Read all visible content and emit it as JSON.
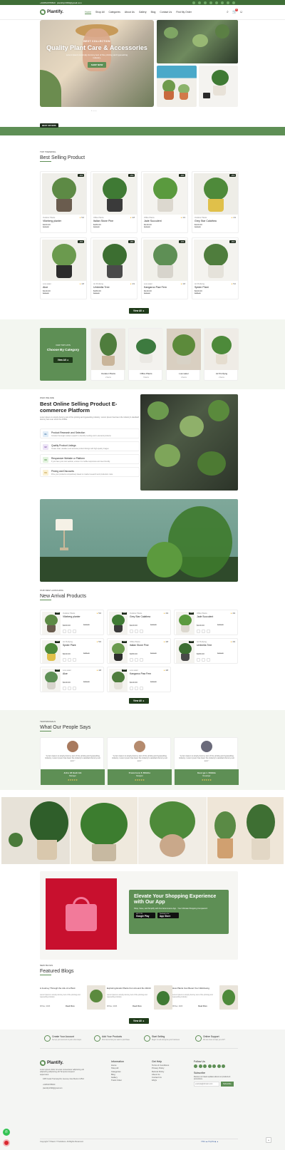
{
  "topbar": {
    "phone": "+919510765810",
    "email": "planttifyr2099@gmail.com"
  },
  "nav": {
    "brand": "Plantify.",
    "menu": [
      "Home",
      "Shop All",
      "Categories",
      "About Us",
      "Gallery",
      "Blog",
      "Contact Us",
      "Find My Order"
    ],
    "cart_count": "0"
  },
  "hero": {
    "kicker": "BEST COLLECTION",
    "title": "Quality Plant Care & Accessories",
    "desc": "Lorem Ipsum is simply dummy text of the printing and typesetting industry.",
    "cta": "SHOP NOW",
    "dots": "• ——"
  },
  "band_tag": "BEST OFFERS",
  "best": {
    "kicker": "TOP TRENDING",
    "title": "Best Selling Product",
    "view_all": "View All",
    "products": [
      {
        "badge": "-16%",
        "cat": "Outdoor Plants",
        "rating": "5.0",
        "name": "Vikeberg planter",
        "price": "$100.00",
        "old": "$120.00"
      },
      {
        "badge": "-15%",
        "cat": "Office Plants",
        "rating": "4.8",
        "name": "Italian Stone Pine",
        "price": "$180.00",
        "old": "$210.00"
      },
      {
        "badge": "-18%",
        "cat": "Office Plants",
        "rating": "4.9",
        "name": "Jade Succulent",
        "price": "$140.00",
        "old": "$170.00"
      },
      {
        "badge": "-15%",
        "cat": "Outdoor Plants",
        "rating": "4.9",
        "name": "Grey Star Calathea",
        "price": "$120.00",
        "old": "$140.00"
      },
      {
        "badge": "-15%",
        "cat": "Low water",
        "rating": "4.8",
        "name": "Aloe",
        "price": "$140.00",
        "old": "$160.00"
      },
      {
        "badge": "-18%",
        "cat": "Air Purifying",
        "rating": "4.9",
        "name": "Umbrella Tree",
        "price": "$180.00",
        "old": "$220.00"
      },
      {
        "badge": "-13%",
        "cat": "Low water",
        "rating": "4.8",
        "name": "Kangaroo Paw Fern",
        "price": "$140.00",
        "old": "$160.00"
      },
      {
        "badge": "-16%",
        "cat": "Air Purifying",
        "rating": "5.0",
        "name": "Spider Plant",
        "price": "$240.00",
        "old": "$285.00"
      }
    ]
  },
  "categories": {
    "kicker": "OUR TOP CATS",
    "title": "Choose By Category",
    "view_all": "View All",
    "items": [
      {
        "name": "Outdoor Plants",
        "qty": "2 items"
      },
      {
        "name": "Office Plants",
        "qty": "3 items"
      },
      {
        "name": "Low water",
        "qty": "2 items"
      },
      {
        "name": "Air Purifying",
        "qty": "2 items"
      }
    ]
  },
  "about": {
    "kicker": "WHO WE ARE",
    "title": "Best Online Selling Product E-commerce Platform",
    "desc": "Lorem Ipsum is simply dummy text of the printing and typesetting industry. Lorem Ipsum has been the industry's standard dummy text ever since the 1500s.",
    "steps": [
      {
        "num": "01",
        "title": "Product Research and Selection",
        "desc": "Conduct thorough market research to identify trending and in-demand products."
      },
      {
        "num": "02",
        "title": "Quality Product Listings",
        "desc": "Create clear, detailed, and accurate product listings with high-quality images."
      },
      {
        "num": "03",
        "title": "Responsive Website or Platform",
        "desc": "If you have your own website, ensure it is mobile-responsive and user-friendly."
      },
      {
        "num": "04",
        "title": "Pricing and Discounts",
        "desc": "Price your products competitively based on market research and production costs."
      }
    ]
  },
  "arrivals": {
    "kicker": "OUR NEW LAUNCHING",
    "title": "New Arrival Products",
    "view_all": "View All",
    "products": [
      {
        "badge": "-16%",
        "cat": "Outdoor Plants",
        "rating": "5.0",
        "name": "Vikeberg planter",
        "price": "$100.00",
        "old": "$120.00"
      },
      {
        "badge": "-15%",
        "cat": "Outdoor Plants",
        "rating": "4.9",
        "name": "Grey Star Calathea",
        "price": "$120.00",
        "old": "$140.00"
      },
      {
        "badge": "-18%",
        "cat": "Office Plants",
        "rating": "4.9",
        "name": "Jade Succulent",
        "price": "$140.00",
        "old": "$170.00"
      },
      {
        "badge": "-16%",
        "cat": "Air Purifying",
        "rating": "5.0",
        "name": "Spider Plant",
        "price": "$240.00",
        "old": "$285.00"
      },
      {
        "badge": "-15%",
        "cat": "Office Plants",
        "rating": "4.8",
        "name": "Italian Stone Pine",
        "price": "$180.00",
        "old": "$210.00"
      },
      {
        "badge": "-18%",
        "cat": "Air Purifying",
        "rating": "4.9",
        "name": "Umbrella Tree",
        "price": "$180.00",
        "old": "$220.00"
      },
      {
        "badge": "-15%",
        "cat": "Low water",
        "rating": "4.8",
        "name": "Aloe",
        "price": "$140.00",
        "old": "$160.00"
      },
      {
        "badge": "-13%",
        "cat": "Low water",
        "rating": "4.8",
        "name": "Kangaroo Paw Fern",
        "price": "$140.00",
        "old": "$160.00"
      }
    ]
  },
  "testimonials": {
    "kicker": "TESTIMONIALS",
    "title": "What Our People Says",
    "quote": "\"Lorem Ipsum is simply dummy text of the printing and typesetting industry. Lorem Ipsum has been the industry's standard dummy text ever.\"",
    "items": [
      {
        "name": "Jolie M Hedrick",
        "role": "Manager"
      },
      {
        "name": "Francisca S Dibble",
        "role": "Designer"
      },
      {
        "name": "George L Dibble",
        "role": "Developer"
      }
    ],
    "stars": "★★★★★"
  },
  "app": {
    "title": "Elevate Your Shopping Experience with Our App",
    "desc": "Shop, Save, and Simplify with Our Ecommerce App - Your Ultimate Shopping Companion!",
    "google": "Google Play",
    "apple": "App Store",
    "google_small": "GET IT ON",
    "apple_small": "Download on the"
  },
  "blogs": {
    "kicker": "NEW BLOGS",
    "title": "Featured Blogs",
    "view_all": "View All",
    "items": [
      {
        "title": "A Journey Through the Life of a Plant",
        "desc": "Lorem Ipsum is simply dummy text of the printing and typesetting industry.",
        "date": "08 Dec, 2023",
        "more": "Read More"
      },
      {
        "title": "Exploring Exotic Plants from Around the World",
        "desc": "Lorem Ipsum is simply dummy text of the printing and typesetting industry.",
        "date": "08 Dec, 2023",
        "more": "Read More"
      },
      {
        "title": "How Plants Can Boost Your Well-being",
        "desc": "Lorem Ipsum is simply dummy text of the printing and typesetting industry.",
        "date": "08 Dec, 2023",
        "more": "Read More"
      }
    ]
  },
  "features": [
    {
      "title": "Create Your Account",
      "desc": "Set up your account in just a few steps"
    },
    {
      "title": "Add Your Products",
      "desc": "Pick items that you want to purchase"
    },
    {
      "title": "Start Selling",
      "desc": "Begin to sell and grow your business"
    },
    {
      "title": "Online Support",
      "desc": "We are here to help you 24/7"
    }
  ],
  "footer": {
    "brand": "Plantify.",
    "about": "Lorem ipsum dolor sit amet consectetur adipiscing elit adipiscing adipiscing elit Tempora torquent aspernatur.",
    "address": "4305 Cedar Tramway Rd, Geneva, New Mexico 12512",
    "phone": "+919510765810",
    "email": "planttifyr2099@gmail.com",
    "info_h": "Information",
    "info": [
      "Home",
      "Shop All",
      "Categories",
      "Blog",
      "Gallery",
      "Track Order"
    ],
    "help_h": "Get Help",
    "help": [
      "Terms & Conditions",
      "Privacy Policy",
      "Refund Policy",
      "About Us",
      "Contact Us",
      "FAQs"
    ],
    "follow_h": "Follow Us",
    "subscribe_h": "Subscribe",
    "subscribe_desc": "Receive our latest updates about our products & promotions.",
    "email_placeholder": "example@domain.com",
    "subscribe_btn": "Subscribe",
    "copyright": "Copyright © Plaurn IT Solutions. All Rights Reserved.",
    "payments": "VISA  ●●  PayPal  ◆  ▲"
  },
  "colors": {
    "brand": "#5e8f55",
    "dark": "#1d2a1b",
    "topbar": "#3f6e37"
  }
}
